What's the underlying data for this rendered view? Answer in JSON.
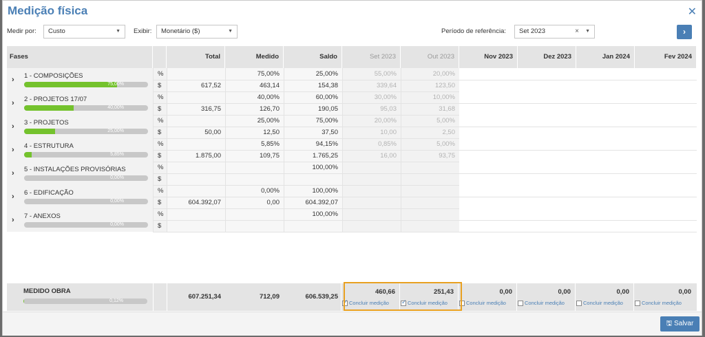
{
  "dialog": {
    "title": "Medição física"
  },
  "controls": {
    "medir_label": "Medir por:",
    "medir_value": "Custo",
    "exibir_label": "Exibir:",
    "exibir_value": "Monetário ($)",
    "periodo_label": "Período de referência:",
    "periodo_value": "Set 2023"
  },
  "columns": [
    "Fases",
    "Total",
    "Medido",
    "Saldo",
    "Set 2023",
    "Out 2023",
    "Nov 2023",
    "Dez 2023",
    "Jan 2024",
    "Fev 2024"
  ],
  "phases": [
    {
      "name": "1 - COMPOSIÇÕES",
      "progress": "75,00%",
      "progress_value": 75,
      "pct": [
        "",
        "75,00%",
        "25,00%",
        "55,00%",
        "20,00%"
      ],
      "money": [
        "617,52",
        "463,14",
        "154,38",
        "339,64",
        "123,50"
      ]
    },
    {
      "name": "2 - PROJETOS 17/07",
      "progress": "40,00%",
      "progress_value": 40,
      "pct": [
        "",
        "40,00%",
        "60,00%",
        "30,00%",
        "10,00%"
      ],
      "money": [
        "316,75",
        "126,70",
        "190,05",
        "95,03",
        "31,68"
      ]
    },
    {
      "name": "3 - PROJETOS",
      "progress": "25,00%",
      "progress_value": 25,
      "pct": [
        "",
        "25,00%",
        "75,00%",
        "20,00%",
        "5,00%"
      ],
      "money": [
        "50,00",
        "12,50",
        "37,50",
        "10,00",
        "2,50"
      ]
    },
    {
      "name": "4 - ESTRUTURA",
      "progress": "5,85%",
      "progress_value": 5.85,
      "pct": [
        "",
        "5,85%",
        "94,15%",
        "0,85%",
        "5,00%"
      ],
      "money": [
        "1.875,00",
        "109,75",
        "1.765,25",
        "16,00",
        "93,75"
      ]
    },
    {
      "name": "5 - INSTALAÇÕES PROVISÓRIAS",
      "progress": "0,00%",
      "progress_value": 0,
      "pct": [
        "",
        "",
        "100,00%",
        "",
        ""
      ],
      "money": [
        "",
        "",
        "",
        "",
        ""
      ]
    },
    {
      "name": "6 - EDIFICAÇÃO",
      "progress": "0,00%",
      "progress_value": 0,
      "pct": [
        "",
        "0,00%",
        "100,00%",
        "",
        ""
      ],
      "money": [
        "604.392,07",
        "0,00",
        "604.392,07",
        "",
        ""
      ]
    },
    {
      "name": "7 - ANEXOS",
      "progress": "0,00%",
      "progress_value": 0,
      "pct": [
        "",
        "",
        "100,00%",
        "",
        ""
      ],
      "money": [
        "",
        "",
        "",
        "",
        ""
      ]
    }
  ],
  "symbols": {
    "pct": "%",
    "money": "$"
  },
  "footer": {
    "label": "MEDIDO OBRA",
    "progress": "0,12%",
    "progress_value": 0.12,
    "total": "607.251,34",
    "medido": "712,09",
    "saldo": "606.539,25",
    "months": [
      {
        "value": "460,66",
        "checked": true
      },
      {
        "value": "251,43",
        "checked": true
      },
      {
        "value": "0,00",
        "checked": false
      },
      {
        "value": "0,00",
        "checked": false
      },
      {
        "value": "0,00",
        "checked": false
      },
      {
        "value": "0,00",
        "checked": false
      }
    ],
    "concluir_label": "Concluir medição"
  },
  "save_label": "Salvar"
}
